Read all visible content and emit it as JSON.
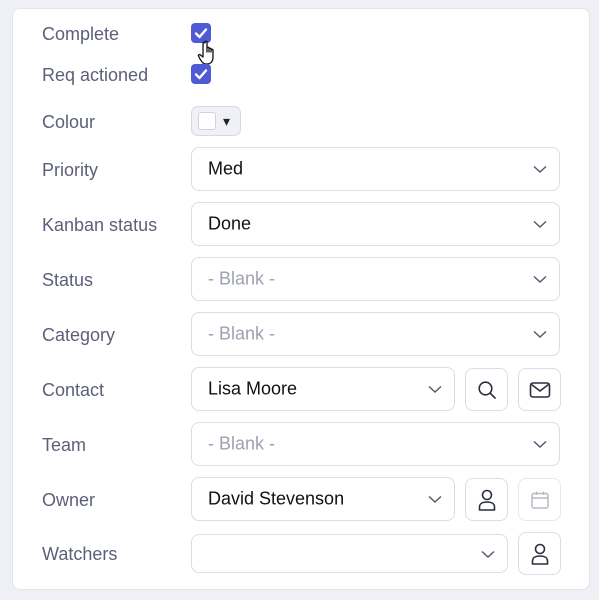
{
  "form": {
    "complete": {
      "label": "Complete",
      "checked": true
    },
    "req_actioned": {
      "label": "Req actioned",
      "checked": true
    },
    "colour": {
      "label": "Colour",
      "value": "#ffffff"
    },
    "priority": {
      "label": "Priority",
      "value": "Med"
    },
    "kanban_status": {
      "label": "Kanban status",
      "value": "Done"
    },
    "status": {
      "label": "Status",
      "value": "- Blank -"
    },
    "category": {
      "label": "Category",
      "value": "- Blank -"
    },
    "contact": {
      "label": "Contact",
      "value": "Lisa Moore"
    },
    "team": {
      "label": "Team",
      "value": "- Blank -"
    },
    "owner": {
      "label": "Owner",
      "value": "David Stevenson"
    },
    "watchers": {
      "label": "Watchers",
      "value": ""
    }
  },
  "icons": {
    "caret": "▾",
    "search": "search-icon",
    "mail": "mail-icon",
    "user": "user-icon",
    "calendar": "calendar-icon",
    "chevron": "chevron-down-icon",
    "check": "check-icon",
    "cursor": "hand-pointer-icon"
  },
  "colors": {
    "accent": "#4f5bd5",
    "label": "#5c5f7a",
    "placeholder": "#9ea2b0"
  }
}
